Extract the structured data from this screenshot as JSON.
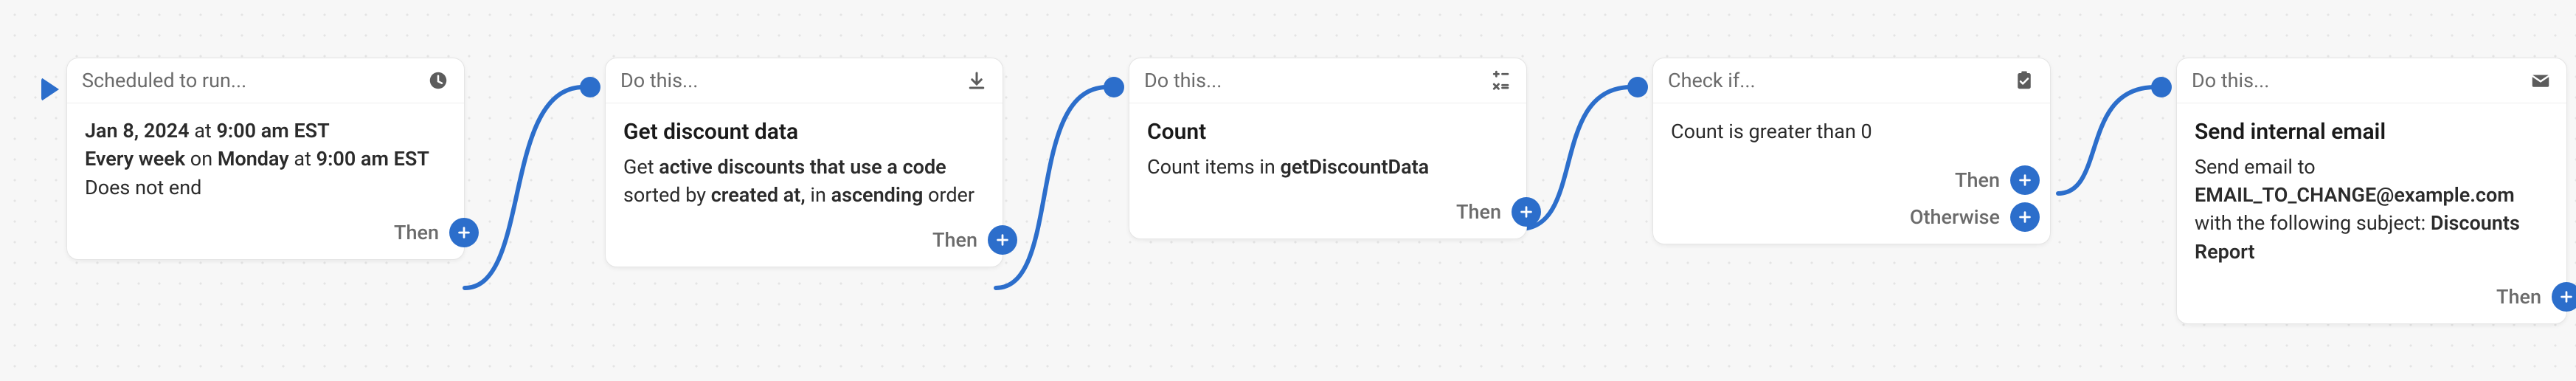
{
  "labels": {
    "then": "Then",
    "otherwise": "Otherwise"
  },
  "nodes": {
    "trigger": {
      "header": "Scheduled to run...",
      "line1_prefix": "Jan 8, 2024",
      "line1_mid": " at ",
      "line1_suffix": "9:00 am EST",
      "line2_a": "Every week",
      "line2_b": " on ",
      "line2_c": "Monday",
      "line2_d": " at ",
      "line2_e": "9:00 am EST",
      "line3": "Does not end"
    },
    "fetch": {
      "header": "Do this...",
      "title": "Get discount data",
      "d1": "Get ",
      "d2": "active discounts that use a code",
      "d3": " sorted by ",
      "d4": "created at,",
      "d5": " in ",
      "d6": "ascending",
      "d7": " order"
    },
    "count": {
      "header": "Do this...",
      "title": "Count",
      "d1": "Count items in ",
      "d2": "getDiscountData"
    },
    "check": {
      "header": "Check if...",
      "body": "Count is greater than 0"
    },
    "email": {
      "header": "Do this...",
      "title": "Send internal email",
      "d1": "Send email to ",
      "d2": "EMAIL_TO_CHANGE@example.com",
      "d3": " with the following subject: ",
      "d4": "Discounts Report"
    }
  }
}
